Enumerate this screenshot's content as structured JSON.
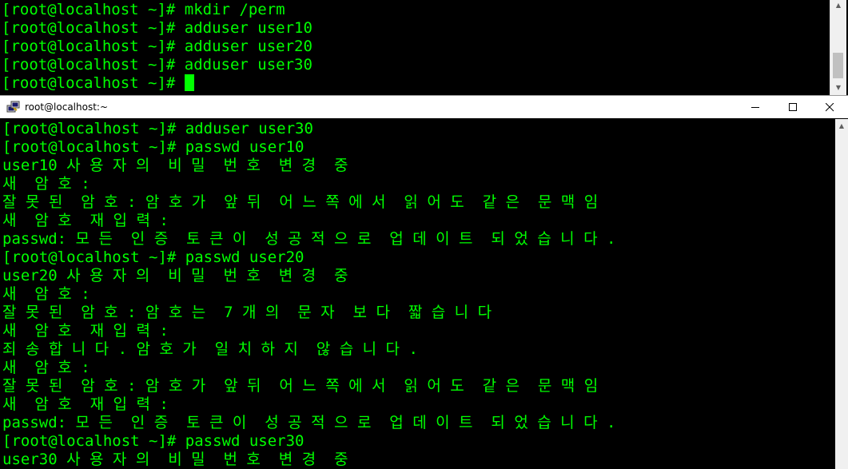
{
  "back_terminal": {
    "lines": [
      "[root@localhost ~]# mkdir /perm",
      "[root@localhost ~]# adduser user10",
      "[root@localhost ~]# adduser user20",
      "[root@localhost ~]# adduser user30",
      "[root@localhost ~]# "
    ]
  },
  "window": {
    "title": "root@localhost:~",
    "icons": {
      "app": "putty-icon",
      "minimize": "minimize-icon",
      "maximize": "maximize-icon",
      "close": "close-icon"
    }
  },
  "terminal": {
    "lines": [
      "[root@localhost ~]# adduser user30",
      "[root@localhost ~]# passwd user10",
      "user10 사 용 자 의  비 밀  번 호  변 경  중",
      "새  암 호 :",
      "잘 못 된  암 호 : 암 호 가  앞 뒤  어 느 쪽 에 서  읽 어 도  같 은  문 맥 임",
      "새  암 호  재 입 력 :",
      "passwd: 모 든  인 증  토 큰 이  성 공 적 으 로  업 데 이 트  되 었 습 니 다 .",
      "[root@localhost ~]# passwd user20",
      "user20 사 용 자 의  비 밀  번 호  변 경  중",
      "새  암 호 :",
      "잘 못 된  암 호 : 암 호 는  7 개 의  문 자  보 다  짧 습 니 다",
      "새  암 호  재 입 력 :",
      "죄 송 합 니 다 . 암 호 가  일 치 하 지  않 습 니 다 .",
      "새  암 호 :",
      "잘 못 된  암 호 : 암 호 가  앞 뒤  어 느 쪽 에 서  읽 어 도  같 은  문 맥 임",
      "새  암 호  재 입 력 :",
      "passwd: 모 든  인 증  토 큰 이  성 공 적 으 로  업 데 이 트  되 었 습 니 다 .",
      "[root@localhost ~]# passwd user30",
      "user30 사 용 자 의  비 밀  번 호  변 경  중"
    ]
  },
  "colors": {
    "terminal_text": "#00ff00",
    "terminal_background": "#000000",
    "titlebar_background": "#ffffff"
  }
}
